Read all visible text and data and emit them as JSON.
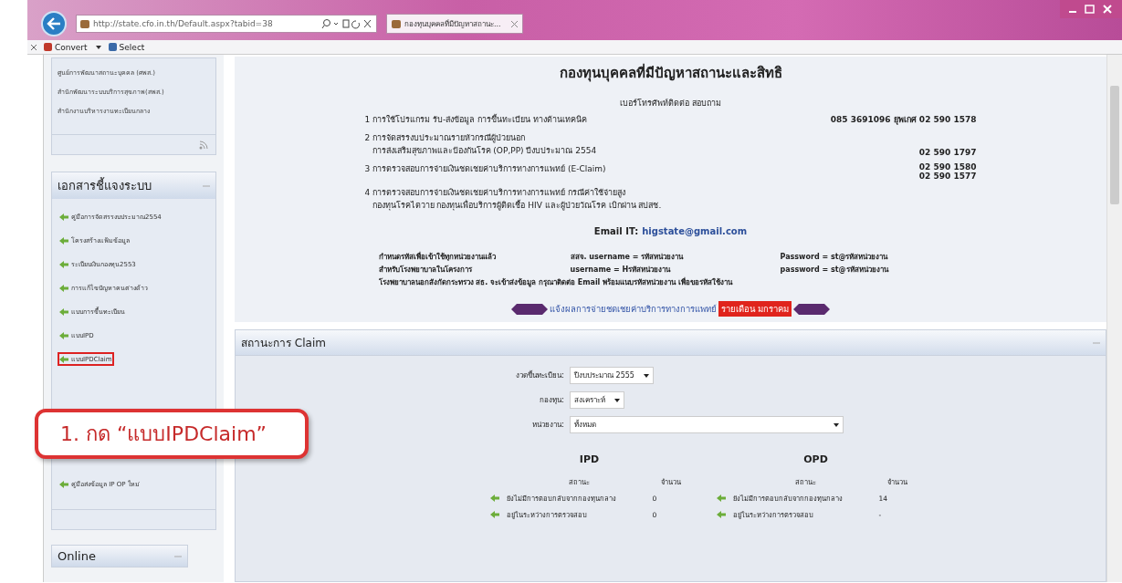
{
  "browser": {
    "url": "http://state.cfo.in.th/Default.aspx?tabid=38",
    "tab_title": "กองทุนบุคคลที่มีปัญหาสถานะ...",
    "toolbar": [
      {
        "kind": "convert",
        "label": "Convert"
      },
      {
        "kind": "select",
        "label": "Select"
      }
    ]
  },
  "sidebar": {
    "links": [
      "ศูนย์การพัฒนาสถานะบุคคล (ศพส.)",
      "สำนักพัฒนาระบบบริการสุขภาพ(สพส.)",
      "สำนักงานบริหารงานทะเบียนกลาง"
    ],
    "docs_panel": {
      "title": "เอกสารชี้แจงระบบ",
      "items": [
        {
          "label": "คู่มือการจัดสรรงบประมาณ2554",
          "highlighted": false
        },
        {
          "label": "โครงสร้างแฟ้มข้อมูล",
          "highlighted": false
        },
        {
          "label": "ระเบียบเงินกองทุน2553",
          "highlighted": false
        },
        {
          "label": "การแก้ไขปัญหาคนต่างด้าว",
          "highlighted": false
        },
        {
          "label": "แบบการขึ้นทะเบียน",
          "highlighted": false
        },
        {
          "label": "แบบIPD",
          "highlighted": false
        },
        {
          "label": "แบบIPDClaim",
          "highlighted": true
        },
        {
          "label": "คู่มือส่งข้อมูล IP OP ใหม่",
          "highlighted": false
        }
      ]
    },
    "online_panel": {
      "title": "Online"
    }
  },
  "callout": {
    "text": "1. กด “แบบIPDClaim”"
  },
  "main": {
    "title": "กองทุนบุคคลที่มีปัญหาสถานะและสิทธิ",
    "contact_heading": "เบอร์โทรศัพท์ติดต่อ สอบถาม",
    "contacts": [
      {
        "lines": [
          "1 การใช้โปรแกรม รับ-ส่งข้อมูล การขึ้นทะเบียน ทางด้านเทคนิค"
        ],
        "phones": [
          "085 3691096 ยุพเกศ 02 590 1578"
        ]
      },
      {
        "lines": [
          "2 การจัดสรรงบประมาณรายหัวกรณีผู้ป่วยนอก",
          "การส่งเสริมสุขภาพและป้องกันโรค (OP,PP) ปีงบประมาณ 2554"
        ],
        "phones": [
          "02 590 1797"
        ]
      },
      {
        "lines": [
          "3 การตรวจสอบการจ่ายเงินชดเชยค่าบริการทางการแพทย์ (E-Claim)"
        ],
        "phones": [
          "02 590 1580",
          "02 590 1577"
        ]
      },
      {
        "lines": [
          "4 การตรวจสอบการจ่ายเงินชดเชยค่าบริการทางการแพทย์ กรณีค่าใช้จ่ายสูง",
          "กองทุนโรคไตวาย กองทุนเพื่อบริการผู้ติดเชื้อ HIV และผู้ป่วยวัณโรค เบิกผ่าน สปสช."
        ]
      }
    ],
    "email_label": "Email IT:",
    "email": "higstate@gmail.com",
    "notes": [
      [
        "กำหนดรหัสเพื่อเข้าใช้ทุกหน่วยงานแล้ว",
        "สสจ. username  =  รหัสหน่วยงาน",
        "Password = st@รหัสหน่วยงาน"
      ],
      [
        "สำหรับโรงพยาบาลในโครงการ",
        "username =  Hรหัสหน่วยงาน",
        "password = st@รหัสหน่วยงาน"
      ],
      [
        "โรงพยาบาลนอกสังกัดกระทรวง สธ. จะเข้าส่งข้อมูล กรุณาติดต่อ Email พร้อมแนบรหัสหน่วยงาน เพื่อขอรหัสใช้งาน"
      ]
    ],
    "banner": {
      "text": "แจ้งผลการจ่ายชดเชยค่าบริการทางการแพทย์",
      "highlight": "รายเดือน มกราคม"
    },
    "claim": {
      "title": "สถานะการ Claim",
      "filters": [
        {
          "label": "งวดขึ้นทะเบียน:",
          "value": "ปีงบประมาณ 2555"
        },
        {
          "label": "กองทุน:",
          "value": "สงเคราะห์"
        },
        {
          "label": "หน่วยงาน:",
          "value": "ทั้งหมด"
        }
      ],
      "groups": [
        {
          "title": "IPD",
          "status_header": "สถานะ",
          "count_header": "จำนวน",
          "rows": [
            {
              "status": "ยังไม่มีการตอบกลับจากกองทุนกลาง",
              "count": "0"
            },
            {
              "status": "อยู่ในระหว่างการตรวจสอบ",
              "count": "0"
            }
          ]
        },
        {
          "title": "OPD",
          "status_header": "สถานะ",
          "count_header": "จำนวน",
          "rows": [
            {
              "status": "ยังไม่มีการตอบกลับจากกองทุนกลาง",
              "count": "14"
            },
            {
              "status": "อยู่ในระหว่างการตรวจสอบ",
              "count": "-"
            }
          ]
        }
      ]
    }
  }
}
